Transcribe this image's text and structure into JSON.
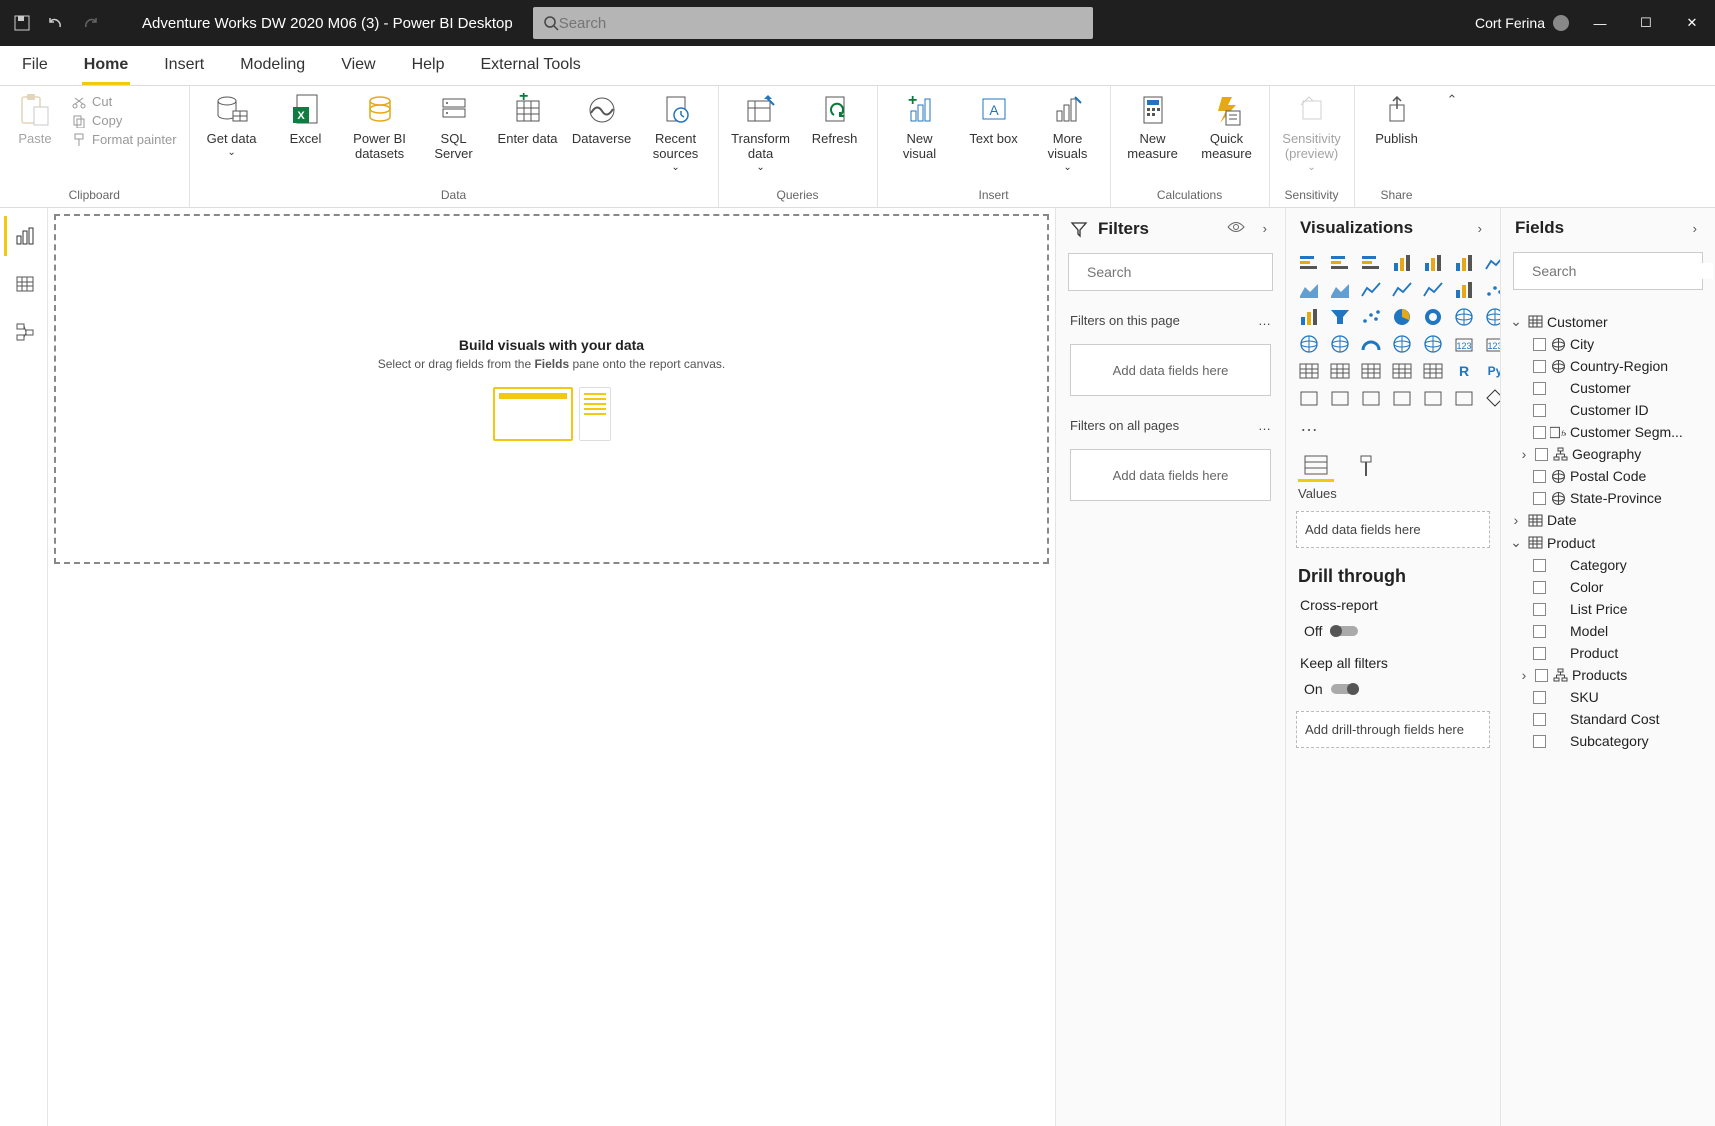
{
  "titlebar": {
    "doc_title": "Adventure Works DW 2020 M06 (3) - Power BI Desktop",
    "search_placeholder": "Search",
    "user_name": "Cort Ferina"
  },
  "menubar": {
    "items": [
      {
        "label": "File"
      },
      {
        "label": "Home",
        "active": true
      },
      {
        "label": "Insert"
      },
      {
        "label": "Modeling"
      },
      {
        "label": "View"
      },
      {
        "label": "Help"
      },
      {
        "label": "External Tools"
      }
    ]
  },
  "ribbon": {
    "clipboard": {
      "paste": "Paste",
      "cut": "Cut",
      "copy": "Copy",
      "format_painter": "Format painter",
      "label": "Clipboard"
    },
    "data": {
      "get_data": "Get data",
      "excel": "Excel",
      "pbi_datasets": "Power BI datasets",
      "sql": "SQL Server",
      "enter": "Enter data",
      "dataverse": "Dataverse",
      "recent": "Recent sources",
      "label": "Data"
    },
    "queries": {
      "transform": "Transform data",
      "refresh": "Refresh",
      "label": "Queries"
    },
    "insert": {
      "new_visual": "New visual",
      "text_box": "Text box",
      "more": "More visuals",
      "label": "Insert"
    },
    "calc": {
      "new_measure": "New measure",
      "quick": "Quick measure",
      "label": "Calculations"
    },
    "sensitivity": {
      "btn": "Sensitivity (preview)",
      "label": "Sensitivity"
    },
    "share": {
      "publish": "Publish",
      "label": "Share"
    }
  },
  "canvas": {
    "title": "Build visuals with your data",
    "sub_pre": "Select or drag fields from the ",
    "sub_bold": "Fields",
    "sub_post": " pane onto the report canvas."
  },
  "filters": {
    "title": "Filters",
    "search_placeholder": "Search",
    "on_page": "Filters on this page",
    "on_all": "Filters on all pages",
    "drop": "Add data fields here"
  },
  "viz": {
    "title": "Visualizations",
    "values": "Values",
    "well": "Add data fields here",
    "drill": "Drill through",
    "cross": "Cross-report",
    "off": "Off",
    "keep": "Keep all filters",
    "on": "On",
    "drill_well": "Add drill-through fields here"
  },
  "fields": {
    "title": "Fields",
    "search_placeholder": "Search",
    "tables": [
      {
        "name": "Customer",
        "expanded": true,
        "fields": [
          {
            "name": "City",
            "icon": "globe"
          },
          {
            "name": "Country-Region",
            "icon": "globe"
          },
          {
            "name": "Customer",
            "icon": ""
          },
          {
            "name": "Customer ID",
            "icon": ""
          },
          {
            "name": "Customer Segm...",
            "icon": "fx"
          },
          {
            "name": "Geography",
            "icon": "hier",
            "expandable": true
          },
          {
            "name": "Postal Code",
            "icon": "globe"
          },
          {
            "name": "State-Province",
            "icon": "globe"
          }
        ]
      },
      {
        "name": "Date",
        "expanded": false,
        "fields": []
      },
      {
        "name": "Product",
        "expanded": true,
        "fields": [
          {
            "name": "Category",
            "icon": ""
          },
          {
            "name": "Color",
            "icon": ""
          },
          {
            "name": "List Price",
            "icon": ""
          },
          {
            "name": "Model",
            "icon": ""
          },
          {
            "name": "Product",
            "icon": ""
          },
          {
            "name": "Products",
            "icon": "hier",
            "expandable": true
          },
          {
            "name": "SKU",
            "icon": ""
          },
          {
            "name": "Standard Cost",
            "icon": ""
          },
          {
            "name": "Subcategory",
            "icon": ""
          }
        ]
      }
    ]
  }
}
